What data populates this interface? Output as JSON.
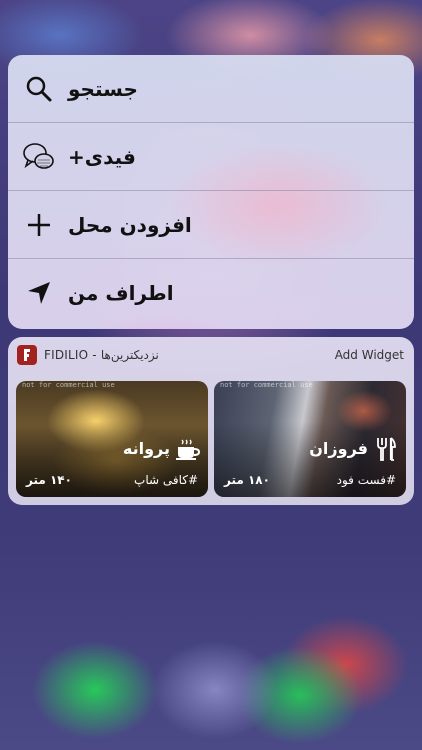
{
  "quick_actions": [
    {
      "label": "جستجو",
      "icon": "search-icon"
    },
    {
      "label": "فیدی+",
      "icon": "chat-bubbles-icon"
    },
    {
      "label": "افزودن محل",
      "icon": "plus-icon"
    },
    {
      "label": "اطراف من",
      "icon": "location-arrow-icon"
    }
  ],
  "widget": {
    "title": "FIDILIO - نزدیکترین‌ها",
    "add_widget_label": "Add Widget",
    "app_icon": "fidilio-logo-icon",
    "accent_color": "#a2221e",
    "cards": [
      {
        "name": "فروزان",
        "category": "#فست فود",
        "distance": "۱۸۰ متر",
        "icon": "fork-knife-icon",
        "watermark": "not for commercial use"
      },
      {
        "name": "پروانه",
        "category": "#کافی شاپ",
        "distance": "۱۴۰ متر",
        "icon": "coffee-cup-icon",
        "watermark": "not for commercial use"
      }
    ]
  }
}
